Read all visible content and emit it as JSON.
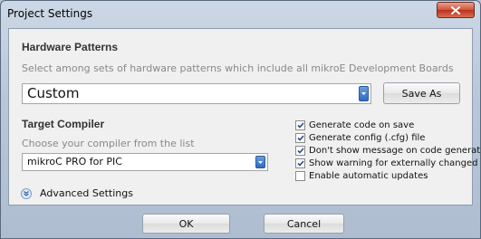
{
  "window": {
    "title": "Project Settings"
  },
  "hardware": {
    "heading": "Hardware Patterns",
    "hint": "Select among sets of hardware patterns which include all mikroE Development Boards",
    "pattern_value": "Custom",
    "save_as_label": "Save As"
  },
  "compiler": {
    "heading": "Target Compiler",
    "hint": "Choose your compiler from the list",
    "value": "mikroC PRO for PIC"
  },
  "options": [
    {
      "label": "Generate code on save",
      "checked": true
    },
    {
      "label": "Generate config (.cfg) file",
      "checked": true
    },
    {
      "label": "Don't show message on code generation",
      "checked": true
    },
    {
      "label": "Show warning for externally changed files",
      "checked": true
    },
    {
      "label": "Enable automatic updates",
      "checked": false
    }
  ],
  "advanced": {
    "label": "Advanced Settings"
  },
  "footer": {
    "ok_label": "OK",
    "cancel_label": "Cancel"
  },
  "icons": {
    "close": "close-icon",
    "dropdown": "chevron-down-icon",
    "checkmark": "checkmark-icon",
    "expand": "double-chevron-down-icon"
  },
  "colors": {
    "close_button": "#cf5339",
    "combo_arrow": "#2f6cc0",
    "content_bg": "#f0f0f0"
  }
}
